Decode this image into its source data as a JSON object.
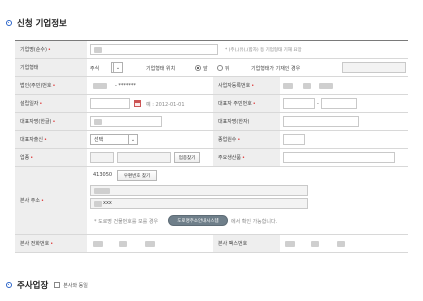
{
  "section1": {
    "title": "신청 기업정보"
  },
  "section2": {
    "title": "주사업장",
    "checkbox_label": "본사와 동일"
  },
  "rows": {
    "company_name": {
      "label": "기업명(순수)",
      "hint": "* (주),(유),(합자) 등 기업형태 기재 요망"
    },
    "company_type": {
      "label": "기업형태",
      "select": "주식",
      "pos_label": "기업형태 위치",
      "radio_front": "앞",
      "radio_back": "뒤",
      "pos_hint": "기업형태가 기재인 경우"
    },
    "corp_number": {
      "label": "법인(주민)번호",
      "masked": "- *******",
      "biz_label": "사업자등록번호"
    },
    "est_date": {
      "label": "설립일자",
      "date_hint": "예 : 2012-01-01",
      "ceo_rrn_label": "대표자 주민번호"
    },
    "ceo_name_kr": {
      "label": "대표자명(한글)",
      "ceo_name_cn_label": "대표자명(한자)"
    },
    "ceo_origin": {
      "label": "대표자출신",
      "select": "선택",
      "employees_label": "종업원수"
    },
    "industry": {
      "label": "업종",
      "search_btn": "업종찾기",
      "product_label": "주요생산품"
    },
    "hq_address": {
      "label": "본사 주소",
      "zip": "413050",
      "zip_btn": "우편번호 찾기",
      "road_note": "* 도로명 건물번호를 모를 경우",
      "road_btn": "도로명주소안내시스템",
      "road_note2": "에서 확인 가능합니다.",
      "fax_partial": "xxx"
    },
    "hq_phone": {
      "label": "본사 전화번호",
      "fax_label": "본사 팩스번호"
    }
  },
  "colors": {
    "accent": "#2b64c8",
    "required": "#d33333",
    "label_bg": "#eeeeee"
  }
}
